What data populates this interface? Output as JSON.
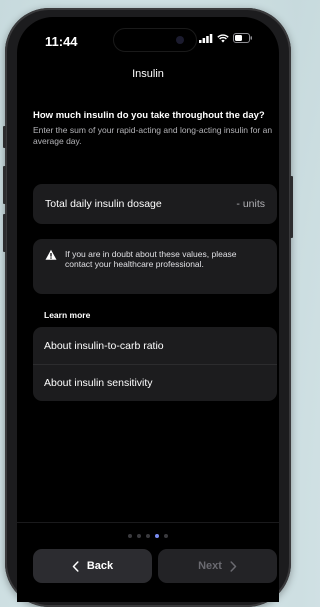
{
  "status_bar": {
    "time": "11:44"
  },
  "nav": {
    "title": "Insulin"
  },
  "question": {
    "title": "How much insulin do you take throughout the day?",
    "hint": "Enter the sum of your rapid-acting and long-acting insulin for an average day."
  },
  "dosage": {
    "label": "Total daily insulin dosage",
    "value": "- units"
  },
  "warning": {
    "icon": "warning-triangle-icon",
    "text": "If you are in doubt about these values, please contact your healthcare professional."
  },
  "learn_more": {
    "label": "Learn more",
    "items": [
      {
        "label": "About insulin-to-carb ratio"
      },
      {
        "label": "About insulin sensitivity"
      }
    ]
  },
  "pager": {
    "total": 5,
    "active_index": 3
  },
  "buttons": {
    "back_label": "Back",
    "next_label": "Next"
  },
  "colors": {
    "accent": "#7a8cf0",
    "background": "#000000",
    "card": "#1c1c1e"
  }
}
